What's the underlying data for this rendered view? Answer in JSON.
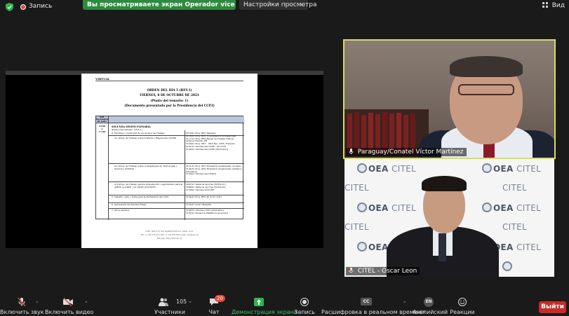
{
  "topbar": {
    "recording_label": "Запись",
    "share_banner": "Вы просматриваете экран Operador vice - Evandro Diefen...",
    "view_options": "Настройки просмотра",
    "view_button": "Вид"
  },
  "document": {
    "virtual": "VIRTUAL",
    "title_lines": [
      "ORDEN DEL DÍA 5 (REV.1)",
      "VIERNES, 8 DE OCTUBRE DE 2021",
      "(Punto del temario: 1)",
      "(Documento presentado por la Presidencia del CCP.I)"
    ],
    "table_header": "EDT\nWashington,\nDC hours",
    "time_range": "14:00\na\n17:00",
    "section_title": "SEGUNDA SESIÓN PLENARIA",
    "section_sub": "(Puntos del temario: 4,5,6,7)",
    "items": [
      {
        "text": "4.  Informes y reuniones de los Grupos de Trabajo:",
        "docs": ""
      },
      {
        "text": "4.1    Grupo de Trabajo sobre Políticas y Regulación (GTPR)",
        "docs": "5076/21  Proy. REC Plenaria\n5116/21  Proy. DEC Coordinación Discapacidad\n5117/21  Proy. RES Mesas de Trabajo Diálogo Avances Estudio PR\n5156/21  Proy. DEC - OEA Rec. 2035- Fomento\n5181/21  Informe del GTPR – 39 CCP.I\n5148/21  Informe del GTPR (2018-2021)"
      },
      {
        "text": "4.2    Grupo de Trabajo sobre el Despliegue de Tecnologías y Servicios (GTDTS)",
        "docs": "5121/21  Proy. DEC Extensión Cuestionario docente\n5134/21  Proy. DEC Extensión Cuestionario términos relevantes\n5159/21  Informe del GTDTS"
      },
      {
        "text": "4.3    Grupo de Trabajo para la preparación y seguimiento para la AMNT, la CMDT y la CMDT (GTCONF)",
        "docs": "5097/21  Tabla de Aportes (WTDC-21)\n5098/21  Tabla de Aportes (WTSA-20)\n5158/21  Informe GTCONF"
      },
      {
        "text": "5.  Temario, sede y fecha para la 40 Reunión del CCP.I",
        "docs": "5154/21  Proy. RES 40 & 41 CCP.I"
      },
      {
        "text": "6.  Aprobación del Informe Final.",
        "docs": "5155/21  Acta I Plenaria"
      },
      {
        "text": "7.  Otros asuntos:",
        "docs": "5160/21  Informe CCP.I (2018-2021)\n5182/21  Situación Miembros Asociados"
      }
    ],
    "footer_lines": [
      "CITEL 1889 F ST. NW, WASHINGTON D.C. 20006, U.S.A.",
      "TEL: +1 202 370 4713   FAX: +1 202 458 6854   e-mail: citel@oas.org",
      "Web page: http://citel.oas.org"
    ]
  },
  "participants": [
    {
      "name": "Paraguay/Conatel Víctor Martínez",
      "active_speaker": true,
      "highlight_color": "#d4e157"
    },
    {
      "name": "CITEL - Oscar Leon",
      "active_speaker": false
    }
  ],
  "background_logo": {
    "oea": "OEA",
    "citel": "CITEL"
  },
  "toolbar": {
    "mute": "Включить звук",
    "video": "Включить видео",
    "participants": "Участники",
    "participants_count": "105",
    "chat": "Чат",
    "chat_badge": "20",
    "share": "Демонстрация экрана",
    "record": "Запись",
    "captions": "Расшифровка в реальном времени",
    "captions_icon": "CC",
    "language": "Английский",
    "language_icon": "EN",
    "reactions": "Реакции",
    "leave": "Выйти"
  },
  "colors": {
    "share_banner": "#2d8a3e",
    "leave": "#c92a2a",
    "share_icon": "#2fb34f",
    "badge": "#e0483b"
  }
}
